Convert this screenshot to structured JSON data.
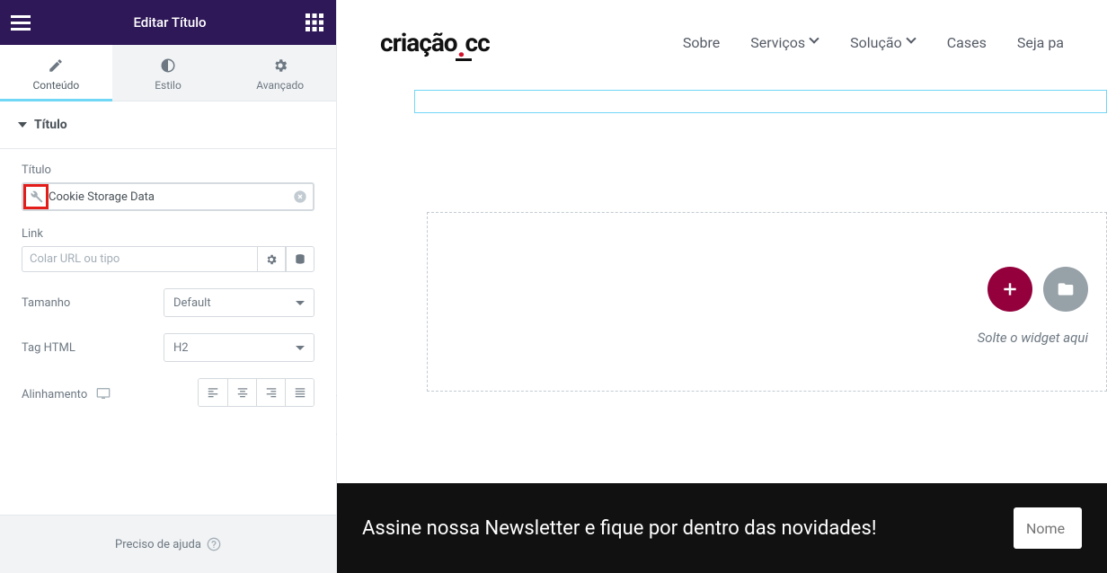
{
  "panel": {
    "title": "Editar Título",
    "tabs": {
      "content": "Conteúdo",
      "style": "Estilo",
      "advanced": "Avançado"
    },
    "section_title": "Título",
    "fields": {
      "title_label": "Título",
      "title_value": "Cookie Storage Data",
      "link_label": "Link",
      "link_placeholder": "Colar URL ou tipo",
      "size_label": "Tamanho",
      "size_value": "Default",
      "tag_label": "Tag HTML",
      "tag_value": "H2",
      "align_label": "Alinhamento"
    },
    "help": "Preciso de ajuda"
  },
  "site": {
    "logo_a": "criação",
    "logo_b": "cc",
    "nav": {
      "sobre": "Sobre",
      "servicos": "Serviços",
      "solucao": "Solução",
      "cases": "Cases",
      "seja": "Seja pa"
    },
    "drop_hint": "Solte o widget aqui",
    "newsletter_text": "Assine nossa Newsletter e fique por dentro das novidades!",
    "newsletter_placeholder": "Nome"
  }
}
